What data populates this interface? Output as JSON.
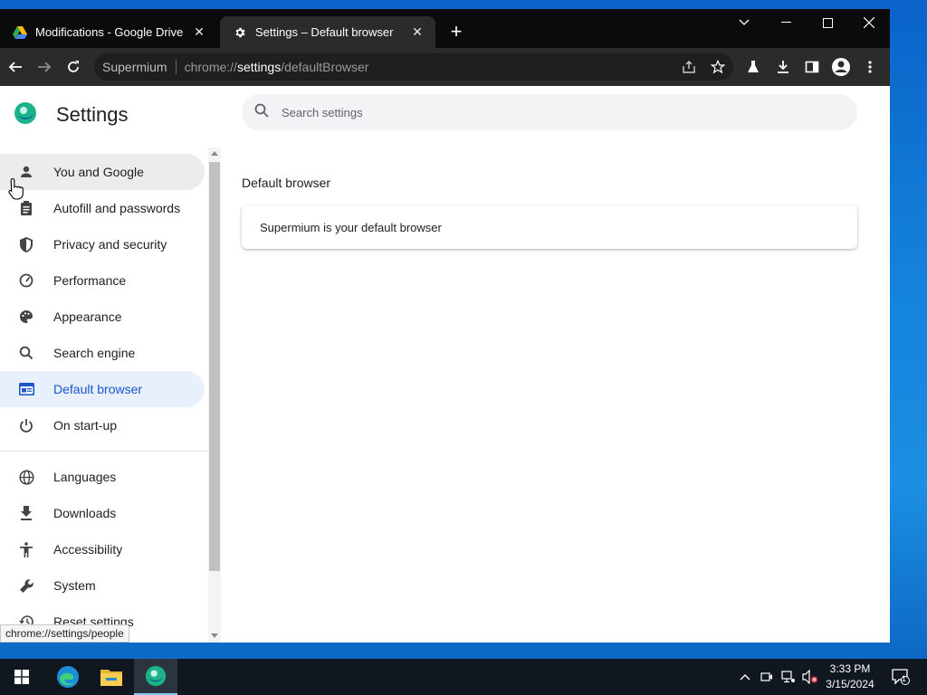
{
  "browser": {
    "tabs": [
      {
        "title": "Modifications - Google Drive",
        "close": "✕"
      },
      {
        "title": "Settings – Default browser",
        "close": "✕"
      }
    ],
    "new_tab": "+",
    "omnibox": {
      "site": "Supermium",
      "url_prefix": "chrome://",
      "url_host": "settings",
      "url_path": "/defaultBrowser"
    }
  },
  "settings": {
    "title": "Settings",
    "search_placeholder": "Search settings",
    "nav": [
      {
        "label": "You and Google",
        "icon": "person-icon"
      },
      {
        "label": "Autofill and passwords",
        "icon": "clipboard-icon"
      },
      {
        "label": "Privacy and security",
        "icon": "shield-icon"
      },
      {
        "label": "Performance",
        "icon": "gauge-icon"
      },
      {
        "label": "Appearance",
        "icon": "palette-icon"
      },
      {
        "label": "Search engine",
        "icon": "search-icon"
      },
      {
        "label": "Default browser",
        "icon": "browser-window-icon"
      },
      {
        "label": "On start-up",
        "icon": "power-icon"
      },
      {
        "label": "Languages",
        "icon": "globe-icon"
      },
      {
        "label": "Downloads",
        "icon": "download-icon"
      },
      {
        "label": "Accessibility",
        "icon": "accessibility-icon"
      },
      {
        "label": "System",
        "icon": "wrench-icon"
      },
      {
        "label": "Reset settings",
        "icon": "history-icon"
      }
    ],
    "section_title": "Default browser",
    "default_status": "Supermium is your default browser"
  },
  "status_bubble": "chrome://settings/people",
  "taskbar": {
    "clock_time": "3:33 PM",
    "clock_date": "3/15/2024",
    "notification_count": "1"
  },
  "colors": {
    "accent": "#1a56c8",
    "active_nav_bg": "#e8f0fe",
    "titlebar": "#0b0b0b",
    "toolbar": "#2b2b2b"
  }
}
